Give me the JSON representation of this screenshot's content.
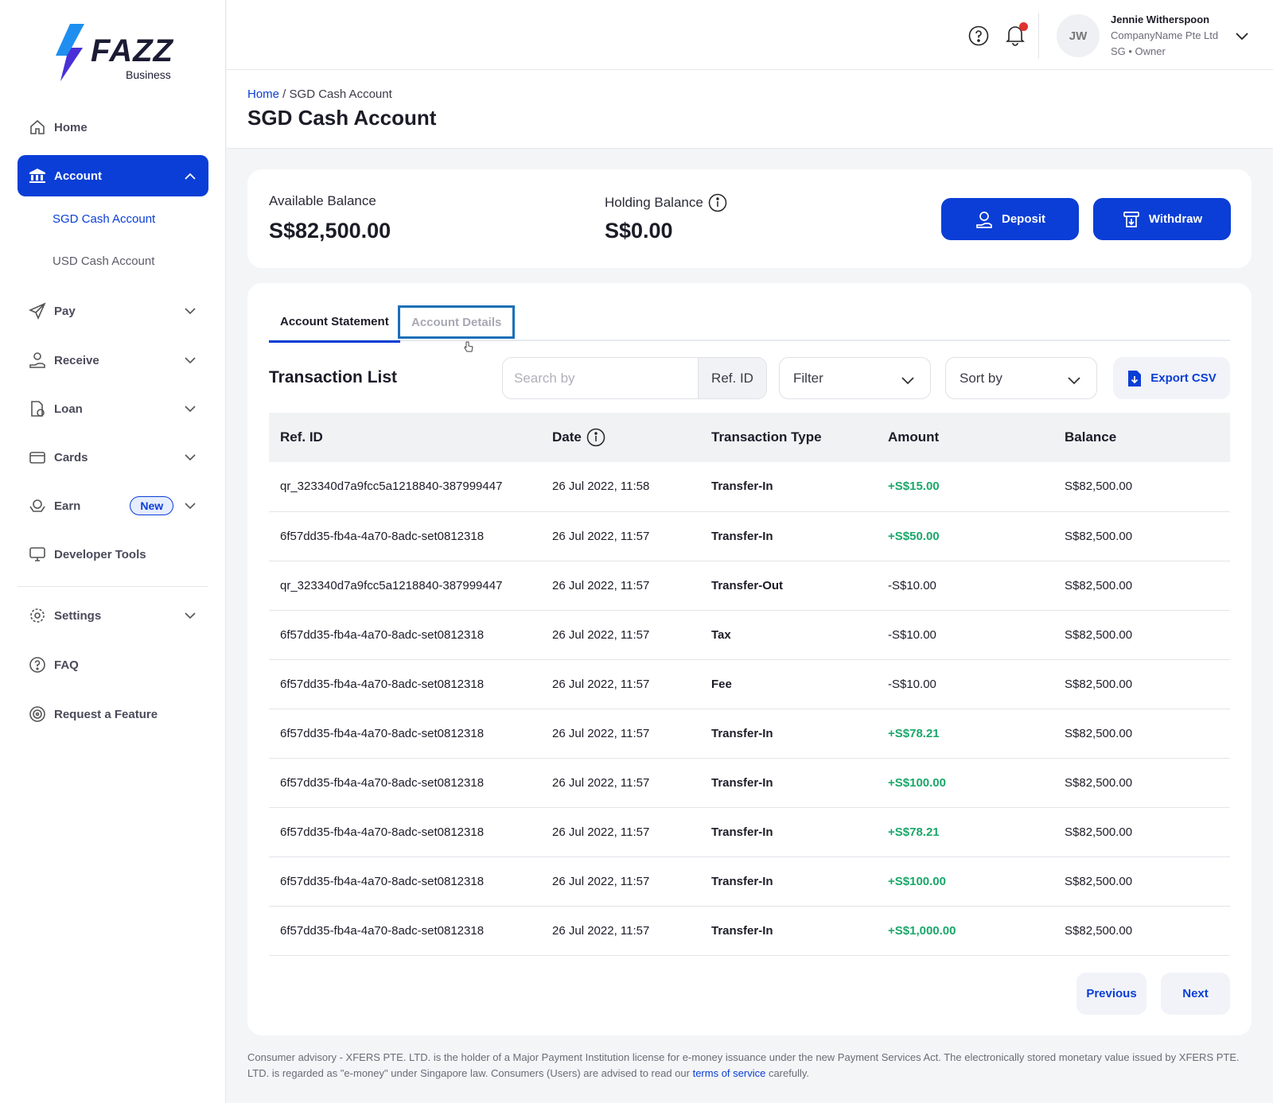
{
  "brand": {
    "name": "FAZZ",
    "sub": "Business",
    "accent": "#0a3ed6",
    "positive": "#1aa76a"
  },
  "sidebar": {
    "home": "Home",
    "account": "Account",
    "sub_sgd": "SGD Cash Account",
    "sub_usd": "USD Cash Account",
    "pay": "Pay",
    "receive": "Receive",
    "loan": "Loan",
    "cards": "Cards",
    "earn": "Earn",
    "earn_badge": "New",
    "dev_tools": "Developer Tools",
    "settings": "Settings",
    "faq": "FAQ",
    "request": "Request a Feature"
  },
  "header": {
    "user_initials": "JW",
    "user_name": "Jennie Witherspoon",
    "company": "CompanyName Pte Ltd",
    "role": "SG • Owner"
  },
  "page": {
    "breadcrumb_home": "Home",
    "breadcrumb_sep": " / ",
    "breadcrumb_current": "SGD Cash Account",
    "title": "SGD Cash Account"
  },
  "balances": {
    "available_label": "Available Balance",
    "available_value": "S$82,500.00",
    "holding_label": "Holding Balance",
    "holding_value": "S$0.00",
    "deposit": "Deposit",
    "withdraw": "Withdraw"
  },
  "tabs": {
    "statement": "Account Statement",
    "details": "Account Details"
  },
  "txlist": {
    "title": "Transaction List",
    "search_placeholder": "Search by",
    "search_suffix": "Ref. ID",
    "filter": "Filter",
    "sort": "Sort by",
    "export": "Export CSV",
    "columns": {
      "ref": "Ref. ID",
      "date": "Date",
      "type": "Transaction Type",
      "amount": "Amount",
      "balance": "Balance"
    },
    "rows": [
      {
        "ref": "qr_323340d7a9fcc5a1218840-387999447",
        "date": "26 Jul 2022, 11:58",
        "type": "Transfer-In",
        "amount": "+S$15.00",
        "balance": "S$82,500.00"
      },
      {
        "ref": "6f57dd35-fb4a-4a70-8adc-set0812318",
        "date": "26 Jul 2022, 11:57",
        "type": "Transfer-In",
        "amount": "+S$50.00",
        "balance": "S$82,500.00"
      },
      {
        "ref": "qr_323340d7a9fcc5a1218840-387999447",
        "date": "26 Jul 2022, 11:57",
        "type": "Transfer-Out",
        "amount": "-S$10.00",
        "balance": "S$82,500.00"
      },
      {
        "ref": "6f57dd35-fb4a-4a70-8adc-set0812318",
        "date": "26 Jul 2022, 11:57",
        "type": "Tax",
        "amount": "-S$10.00",
        "balance": "S$82,500.00"
      },
      {
        "ref": "6f57dd35-fb4a-4a70-8adc-set0812318",
        "date": "26 Jul 2022, 11:57",
        "type": "Fee",
        "amount": "-S$10.00",
        "balance": "S$82,500.00"
      },
      {
        "ref": "6f57dd35-fb4a-4a70-8adc-set0812318",
        "date": "26 Jul 2022, 11:57",
        "type": "Transfer-In",
        "amount": "+S$78.21",
        "balance": "S$82,500.00"
      },
      {
        "ref": "6f57dd35-fb4a-4a70-8adc-set0812318",
        "date": "26 Jul 2022, 11:57",
        "type": "Transfer-In",
        "amount": "+S$100.00",
        "balance": "S$82,500.00"
      },
      {
        "ref": "6f57dd35-fb4a-4a70-8adc-set0812318",
        "date": "26 Jul 2022, 11:57",
        "type": "Transfer-In",
        "amount": "+S$78.21",
        "balance": "S$82,500.00"
      },
      {
        "ref": "6f57dd35-fb4a-4a70-8adc-set0812318",
        "date": "26 Jul 2022, 11:57",
        "type": "Transfer-In",
        "amount": "+S$100.00",
        "balance": "S$82,500.00"
      },
      {
        "ref": "6f57dd35-fb4a-4a70-8adc-set0812318",
        "date": "26 Jul 2022, 11:57",
        "type": "Transfer-In",
        "amount": "+S$1,000.00",
        "balance": "S$82,500.00"
      }
    ],
    "previous": "Previous",
    "next": "Next"
  },
  "footer": {
    "text": "Consumer advisory - XFERS PTE. LTD. is the holder of a Major Payment Institution license for e-money issuance under the new Payment Services Act. The electronically stored monetary value issued by XFERS PTE. LTD. is regarded as \"e-money\" under Singapore law. Consumers (Users) are advised to read our ",
    "link": "terms of service",
    "tail": " carefully."
  }
}
